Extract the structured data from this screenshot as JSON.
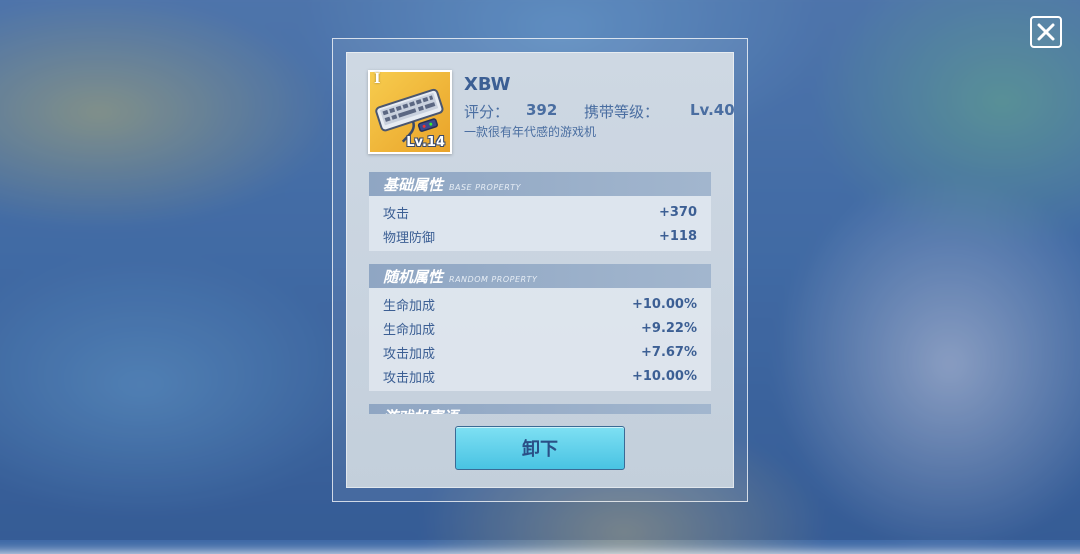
{
  "item": {
    "tier_mark": "I",
    "name": "XBW",
    "level_badge": "Lv.14",
    "score_label": "评分：",
    "score_value": "392",
    "carry_level_label": "携带等级：",
    "carry_level_value": "Lv.40",
    "description": "一款很有年代感的游戏机"
  },
  "base_property": {
    "title": "基础属性",
    "subtitle": "BASE PROPERTY",
    "rows": [
      {
        "name": "攻击",
        "value": "+370"
      },
      {
        "name": "物理防御",
        "value": "+118"
      }
    ]
  },
  "random_property": {
    "title": "随机属性",
    "subtitle": "RANDOM PROPERTY",
    "rows": [
      {
        "name": "生命加成",
        "value": "+10.00%"
      },
      {
        "name": "生命加成",
        "value": "+9.22%"
      },
      {
        "name": "攻击加成",
        "value": "+7.67%"
      },
      {
        "name": "攻击加成",
        "value": "+10.00%"
      }
    ]
  },
  "next_section_peek": "游戏机寄语",
  "unequip_label": "卸下",
  "icons": {
    "close": "close-icon",
    "item": "keyboard-console-icon"
  },
  "colors": {
    "text_blue": "#3c5f94",
    "button_cyan": "#49c3e3",
    "item_gold": "#f7cc4e"
  }
}
